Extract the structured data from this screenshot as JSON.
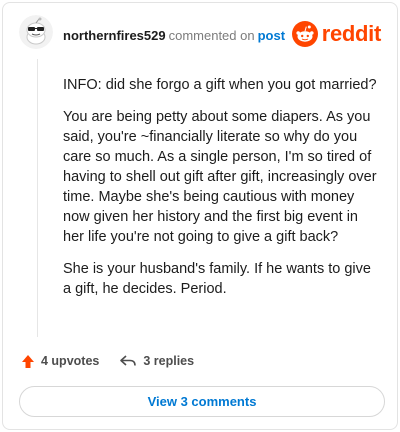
{
  "comment": {
    "author": "northernfires529",
    "action_text": "commented on",
    "post_link": "post",
    "paragraphs": [
      "INFO: did she forgo a gift when you got married?",
      "You are being petty about some diapers. As you said, you're ~financially literate so why do you care so much. As a single person, I'm so tired of having to shell out gift after gift, increasingly over time. Maybe she's being cautious with money now given her history and the first big event in her life you're not going to give a gift back?",
      "She is your husband's family. If he wants to give a gift, he decides. Period."
    ],
    "upvotes": "4 upvotes",
    "replies": "3 replies",
    "view_comments": "View 3 comments"
  },
  "brand": {
    "name": "reddit",
    "color": "#ff4500"
  },
  "icons": {
    "avatar": "snoo-avatar-icon",
    "brand": "reddit-logo-icon",
    "upvote": "upvote-arrow-icon",
    "reply": "reply-arrow-icon"
  },
  "colors": {
    "link": "#0079d3",
    "upvote": "#ff4500"
  }
}
